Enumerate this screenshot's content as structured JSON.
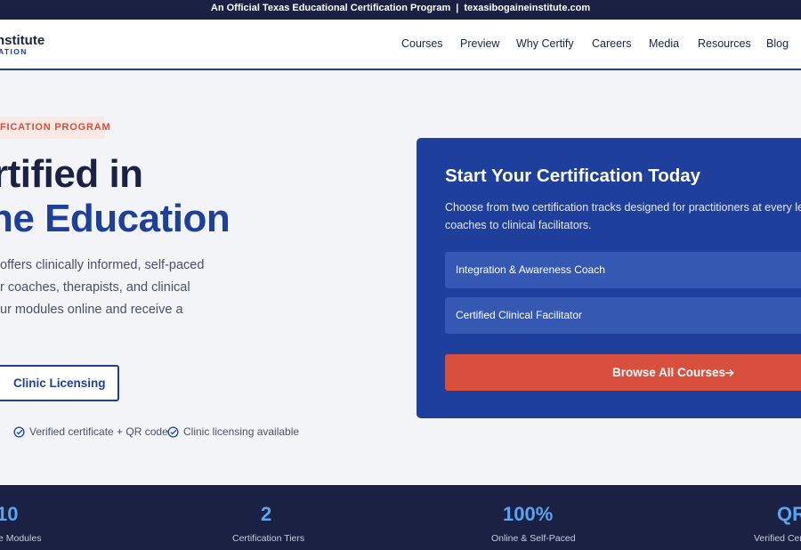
{
  "topbar": {
    "text": "An Official Texas Educational Certification Program",
    "separator": "|",
    "domain": "texasibogaineinstitute.com"
  },
  "brand": {
    "name_fragment": "nstitute",
    "sub_fragment": "ATION"
  },
  "nav": {
    "items": [
      "Courses",
      "Preview",
      "Why Certify",
      "Careers",
      "Media",
      "Resources",
      "Blog"
    ]
  },
  "hero": {
    "eyebrow": "FICATION PROGRAM",
    "headline_line1": "rtified in",
    "headline_line2": "ne Education",
    "paragraph_lines": [
      "offers clinically informed, self-paced",
      "r coaches, therapists, and clinical",
      "ur modules online and receive a"
    ],
    "secondary_button": "Clinic Licensing",
    "checks": [
      "Verified certificate + QR code",
      "Clinic licensing available"
    ]
  },
  "card": {
    "title": "Start Your Certification Today",
    "desc_lines": [
      "Choose from two certification tracks designed for practitioners at every level,",
      "coaches to clinical facilitators."
    ],
    "tracks": [
      "Integration & Awareness Coach",
      "Certified Clinical Facilitator"
    ],
    "cta": "Browse All Courses"
  },
  "stats": [
    {
      "value": "10",
      "label": "e Modules"
    },
    {
      "value": "2",
      "label": "Certification Tiers"
    },
    {
      "value": "100%",
      "label": "Online & Self-Paced"
    },
    {
      "value": "QR",
      "label": "Verified Cer"
    }
  ],
  "colors": {
    "navy": "#1a2142",
    "brand_blue": "#1f3f9c",
    "accent_red": "#d94f3d",
    "stat_blue": "#5aa4f0"
  }
}
